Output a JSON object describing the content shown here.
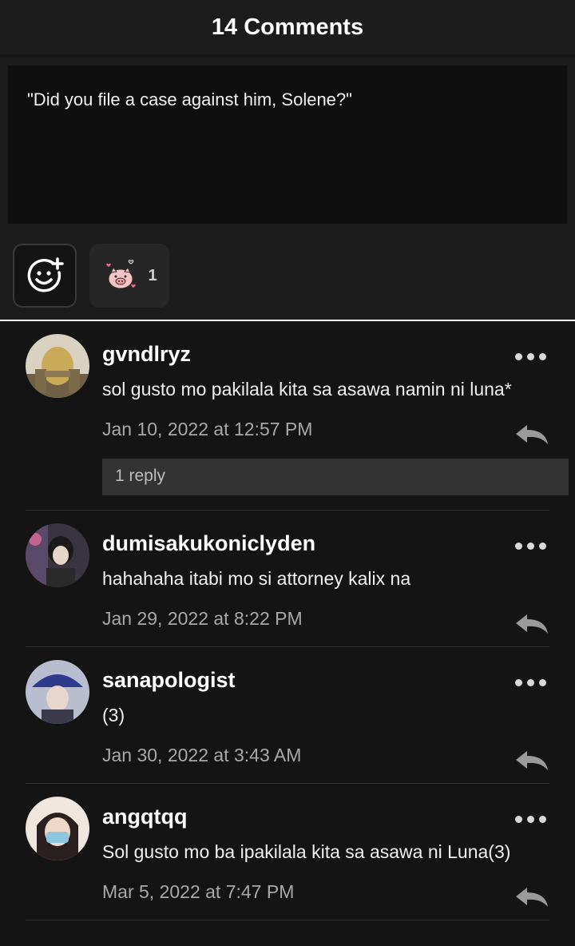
{
  "header": {
    "title": "14 Comments"
  },
  "post": {
    "quote": "\"Did you file a case against him, Solene?\""
  },
  "reactions": {
    "add_icon": "smiley-plus-icon",
    "sticker": "pig-with-hearts-sticker",
    "count": "1"
  },
  "comments": [
    {
      "username": "gvndlryz",
      "text": "sol gusto mo pakilala kita sa asawa namin ni luna*",
      "date": "Jan 10, 2022 at 12:57 PM",
      "replies": "1 reply"
    },
    {
      "username": "dumisakukoniclyden",
      "text": "hahahaha itabi mo si attorney kalix na",
      "date": "Jan 29, 2022 at 8:22 PM"
    },
    {
      "username": "sanapologist",
      "text": "(3)",
      "date": "Jan 30, 2022 at 3:43 AM"
    },
    {
      "username": "angqtqq",
      "text": "Sol gusto mo ba ipakilala kita sa asawa ni Luna(3)",
      "date": "Mar 5, 2022 at 7:47 PM"
    }
  ],
  "colors": {
    "background": "#141414",
    "panel": "#1c1c1c",
    "muted_text": "#a8a8a8"
  }
}
